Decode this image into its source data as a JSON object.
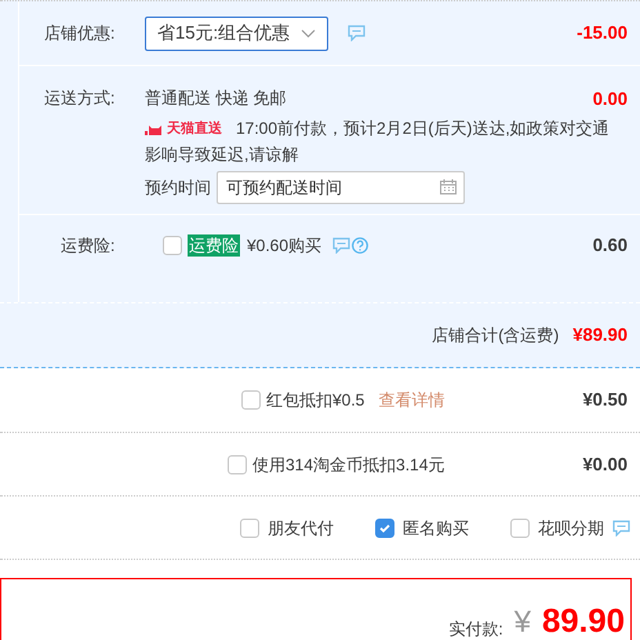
{
  "discount": {
    "label": "店铺优惠:",
    "select": "省15元:组合优惠",
    "amount": "-15.00"
  },
  "shipping": {
    "label": "运送方式:",
    "method": "普通配送 快递 免邮",
    "amount": "0.00",
    "badge": "天猫直送",
    "note": "17:00前付款，预计2月2日(后天)送达,如政策对交通影响导致延迟,请谅解",
    "schedule_label": "预约时间",
    "schedule_placeholder": "可预约配送时间"
  },
  "insurance": {
    "label": "运费险:",
    "checked": false,
    "tag": "运费险",
    "price": "¥0.60购买",
    "amount": "0.60"
  },
  "store_total": {
    "label": "店铺合计(含运费)",
    "amount": "¥89.90"
  },
  "red_packet": {
    "checked": false,
    "label": "红包抵扣¥0.5",
    "link": "查看详情",
    "amount": "¥0.50"
  },
  "coins": {
    "checked": false,
    "label": "使用314淘金币抵扣3.14元",
    "amount": "¥0.00"
  },
  "extras": [
    {
      "label": "朋友代付",
      "checked": false,
      "info": false
    },
    {
      "label": "匿名购买",
      "checked": true,
      "info": false
    },
    {
      "label": "花呗分期",
      "checked": false,
      "info": true
    }
  ],
  "payment": {
    "label": "实付款:",
    "currency": "¥",
    "amount": "89.90"
  }
}
